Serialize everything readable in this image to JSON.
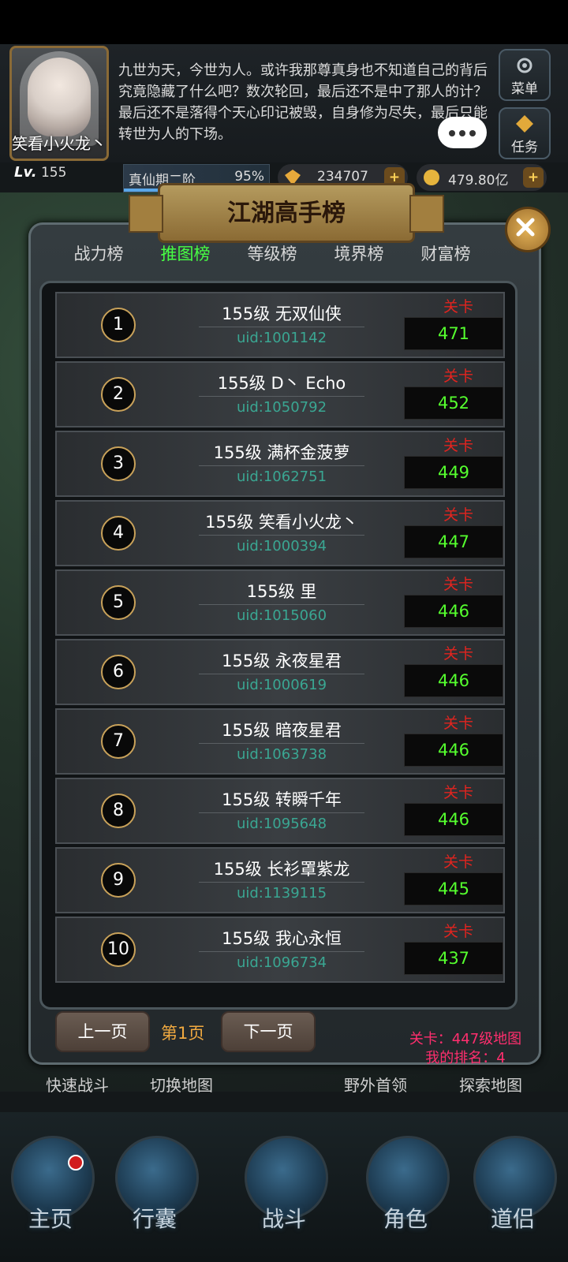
{
  "header": {
    "avatar_name": "笑看小火龙丶",
    "story_text": "九世为天，今世为人。或许我那尊真身也不知道自己的背后究竟隐藏了什么吧？数次轮回，最后还不是中了那人的计？最后还不是落得个天心印记被毁，自身修为尽失，最后只能转世为人的下场。",
    "menu_label": "菜单",
    "task_label": "任务",
    "level": "155",
    "level_prefix": "Lv.",
    "realm": "真仙期二阶",
    "realm_percent": "95%",
    "realm_progress": 0.95,
    "gems": "234707",
    "gold": "479.80亿",
    "plus_label": "+"
  },
  "modal": {
    "title": "江湖高手榜",
    "tabs": [
      "战力榜",
      "推图榜",
      "等级榜",
      "境界榜",
      "财富榜"
    ],
    "active_tab_index": 1,
    "stage_label": "关卡",
    "rows": [
      {
        "rank": "1",
        "name": "155级 无双仙侠",
        "uid": "uid:1001142",
        "stage": "471"
      },
      {
        "rank": "2",
        "name": "155级 D丶 Echo",
        "uid": "uid:1050792",
        "stage": "452"
      },
      {
        "rank": "3",
        "name": "155级 满杯金菠萝",
        "uid": "uid:1062751",
        "stage": "449"
      },
      {
        "rank": "4",
        "name": "155级 笑看小火龙丶",
        "uid": "uid:1000394",
        "stage": "447"
      },
      {
        "rank": "5",
        "name": "155级 里",
        "uid": "uid:1015060",
        "stage": "446"
      },
      {
        "rank": "6",
        "name": "155级 永夜星君",
        "uid": "uid:1000619",
        "stage": "446"
      },
      {
        "rank": "7",
        "name": "155级 暗夜星君",
        "uid": "uid:1063738",
        "stage": "446"
      },
      {
        "rank": "8",
        "name": "155级 转瞬千年",
        "uid": "uid:1095648",
        "stage": "446"
      },
      {
        "rank": "9",
        "name": "155级 长衫罩紫龙",
        "uid": "uid:1139115",
        "stage": "445"
      },
      {
        "rank": "10",
        "name": "155级 我心永恒",
        "uid": "uid:1096734",
        "stage": "437"
      }
    ],
    "prev_page": "上一页",
    "page": "第1页",
    "next_page": "下一页",
    "my_stage": "关卡：447级地图",
    "my_rank": "我的排名：4"
  },
  "background": {
    "quick_battle": "快速战斗",
    "switch_map": "切换地图",
    "field_boss": "野外首领",
    "explore_map": "探索地图"
  },
  "nav": {
    "items": [
      "主页",
      "行囊",
      "战斗",
      "角色",
      "道侣"
    ]
  },
  "colors": {
    "active_tab": "#47ff44",
    "stage_label": "#e2241f",
    "stage_value": "#55ff2e",
    "uid": "#3aa692",
    "my_info": "#ff2e6e",
    "page_num": "#f0a940"
  }
}
